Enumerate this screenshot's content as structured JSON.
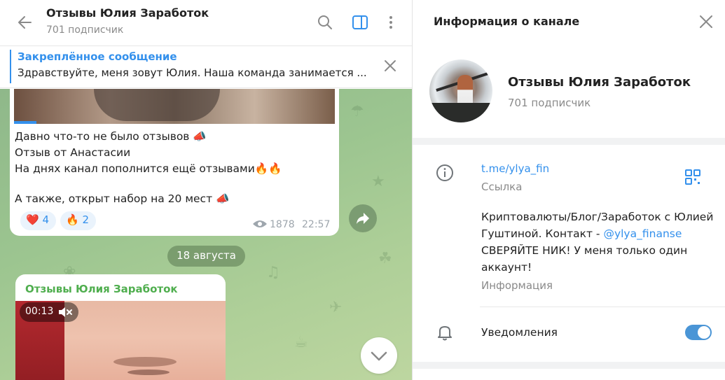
{
  "chat": {
    "title": "Отзывы Юлия Заработок",
    "subscribers": "701 подписчик",
    "icons": [
      "back-arrow-icon",
      "search-icon",
      "sidebar-toggle-icon",
      "more-vertical-icon"
    ],
    "pinned": {
      "label": "Закреплённое сообщение",
      "text": "Здравствуйте, меня зовут Юлия. Наша команда занимается ..."
    },
    "messages": [
      {
        "lines": [
          "Давно что-то не было отзывов 📣",
          "Отзыв от Анастасии",
          "На днях канал пополнится ещё отзывами🔥🔥",
          "",
          "А также, открыт набор на 20 мест 📣"
        ],
        "reactions": [
          {
            "emoji": "❤️",
            "count": "4"
          },
          {
            "emoji": "🔥",
            "count": "2"
          }
        ],
        "views": "1878",
        "time": "22:57"
      },
      {
        "author": "Отзывы Юлия Заработок",
        "video_duration": "00:13"
      }
    ],
    "date_divider": "18 августа"
  },
  "info": {
    "title": "Информация о канале",
    "channel_name": "Отзывы Юлия Заработок",
    "subscribers": "701 подписчик",
    "link": "t.me/ylya_fin",
    "link_caption": "Ссылка",
    "description": {
      "line1": "Криптовалюты/Блог/Заработок с Юлией",
      "line2_prefix": "Гуштиной. Контакт - ",
      "line2_mention": "@ylya_finanse",
      "line3": "СВЕРЯЙТЕ НИК! У меня только один",
      "line4": "аккаунт!"
    },
    "description_caption": "Информация",
    "notifications_label": "Уведомления",
    "notifications_enabled": true
  },
  "colors": {
    "accent": "#3390ec",
    "author": "#4fae4e",
    "toggle": "#4a95d6"
  }
}
